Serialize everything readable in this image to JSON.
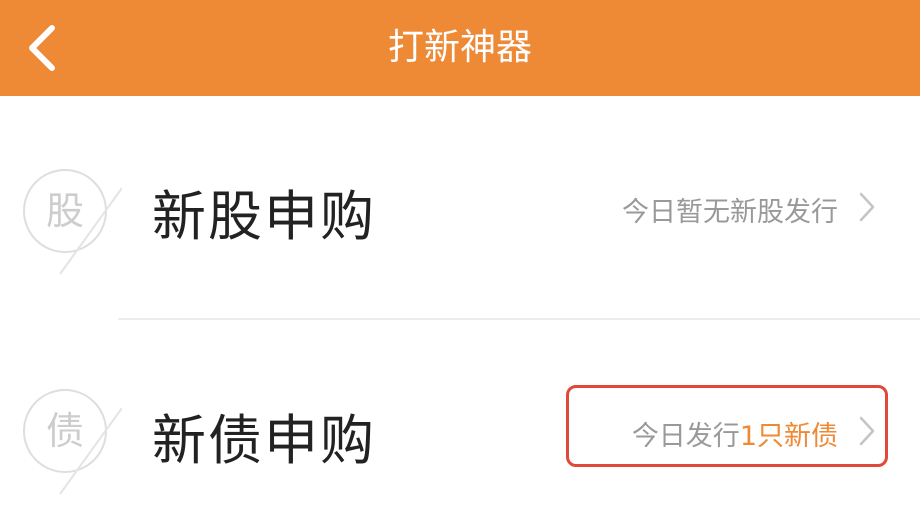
{
  "header": {
    "title": "打新神器",
    "back_icon": "chevron-left-icon",
    "background_color": "#ee8a36"
  },
  "rows": [
    {
      "badge_char": "股",
      "title": "新股申购",
      "status": "今日暂无新股发行",
      "status_highlight": "",
      "chevron_icon": "chevron-right-icon"
    },
    {
      "badge_char": "债",
      "title": "新债申购",
      "status": "今日发行",
      "status_highlight": "1只新债",
      "chevron_icon": "chevron-right-icon",
      "annotated": true,
      "annotation_color": "#e0483a"
    }
  ],
  "colors": {
    "accent": "#ee8a36",
    "title_text": "#222222",
    "status_text": "#999999",
    "badge": "#cdcdcd"
  }
}
